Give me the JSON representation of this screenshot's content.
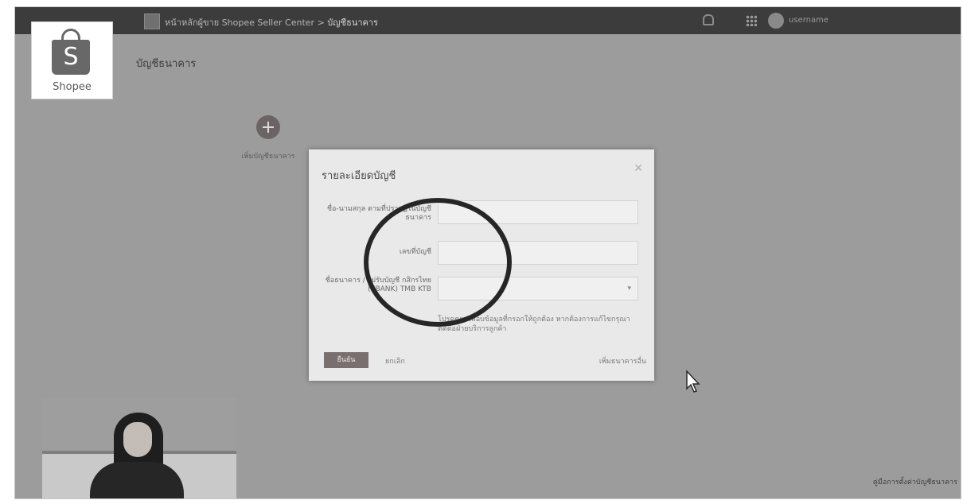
{
  "app": {
    "logo_text": "Shopee",
    "logo_letter": "S"
  },
  "topbar": {
    "breadcrumb_parent": "หน้าหลักผู้ขาย Shopee Seller Center",
    "breadcrumb_separator": ">",
    "breadcrumb_current": "บัญชีธนาคาร",
    "username": "username"
  },
  "page": {
    "title": "บัญชีธนาคาร",
    "add_bank_label": "เพิ่มบัญชีธนาคาร",
    "bottom_link": "คู่มือการตั้งค่าบัญชีธนาคาร"
  },
  "modal": {
    "title": "รายละเอียดบัญชี",
    "close_glyph": "✕",
    "fields": [
      {
        "label": "ชื่อ-นามสกุล ตามที่ปรากฏในบัญชีธนาคาร",
        "value": ""
      },
      {
        "label": "เลขที่บัญชี",
        "value": ""
      },
      {
        "label": "ชื่อธนาคาร / ไม่รับบัญชี กสิกรไทย (KBANK) TMB KTB",
        "value": "",
        "caret": "▾"
      }
    ],
    "note": "โปรดตรวจสอบข้อมูลที่กรอกให้ถูกต้อง หากต้องการแก้ไขกรุณาติดต่อฝ่ายบริการลูกค้า",
    "submit_label": "ยืนยัน",
    "cancel_label": "ยกเลิก",
    "right_link": "เพิ่มธนาคารอื่น"
  },
  "colors": {
    "background_dim": "#9c9c9c",
    "topbar": "#3c3c3c",
    "modal": "#e9e9e9",
    "annotation_circle": "#262626"
  },
  "icons": {
    "home": "home-icon",
    "bell": "bell-icon",
    "apps": "grid-icon",
    "add": "plus-circle-icon",
    "close": "close-icon",
    "cursor": "mouse-cursor-icon"
  }
}
